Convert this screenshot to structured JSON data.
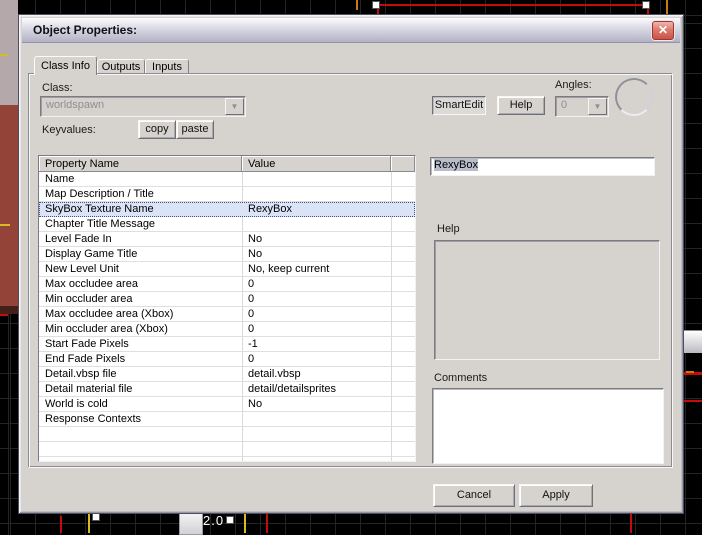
{
  "window": {
    "title": "Object Properties:",
    "close_glyph": "✕"
  },
  "tabs": {
    "class_info": "Class Info",
    "outputs": "Outputs",
    "inputs": "Inputs"
  },
  "class_section": {
    "class_label": "Class:",
    "class_value": "worldspawn",
    "smartedit_label": "SmartEdit",
    "help_label": "Help",
    "angles_label": "Angles:",
    "angles_value": "0",
    "keyvalues_label": "Keyvalues:",
    "copy_label": "copy",
    "paste_label": "paste",
    "dropdown_glyph": "▼"
  },
  "table": {
    "columns": [
      "Property Name",
      "Value"
    ],
    "selected_index": 2,
    "rows": [
      {
        "name": "Name",
        "value": ""
      },
      {
        "name": "Map Description / Title",
        "value": ""
      },
      {
        "name": "SkyBox Texture Name",
        "value": "RexyBox"
      },
      {
        "name": "Chapter Title Message",
        "value": ""
      },
      {
        "name": "Level Fade In",
        "value": "No"
      },
      {
        "name": "Display Game Title",
        "value": "No"
      },
      {
        "name": "New Level Unit",
        "value": "No, keep current"
      },
      {
        "name": "Max occludee area",
        "value": "0"
      },
      {
        "name": "Min occluder area",
        "value": "0"
      },
      {
        "name": "Max occludee area (Xbox)",
        "value": "0"
      },
      {
        "name": "Min occluder area (Xbox)",
        "value": "0"
      },
      {
        "name": "Start Fade Pixels",
        "value": "-1"
      },
      {
        "name": "End Fade Pixels",
        "value": "0"
      },
      {
        "name": "Detail.vbsp file",
        "value": "detail.vbsp"
      },
      {
        "name": "Detail material file",
        "value": "detail/detailsprites"
      },
      {
        "name": "World is cold",
        "value": "No"
      },
      {
        "name": "Response Contexts",
        "value": ""
      }
    ]
  },
  "value_editor": {
    "value": "RexyBox"
  },
  "help_section": {
    "label": "Help",
    "content": ""
  },
  "comments_section": {
    "label": "Comments",
    "content": ""
  },
  "buttons": {
    "cancel": "Cancel",
    "apply": "Apply"
  },
  "background": {
    "zoom_label": "2.0"
  },
  "colors": {
    "selection_red": "#c40c0c",
    "grid_line": "#242424",
    "selected_row_bg": "#dbe3f6",
    "titlebar_gradient_bottom": "#b2b1c5",
    "close_button_red": "#c94f45",
    "view3d_wall": "#b5a8ab",
    "view3d_floor": "#944338"
  }
}
